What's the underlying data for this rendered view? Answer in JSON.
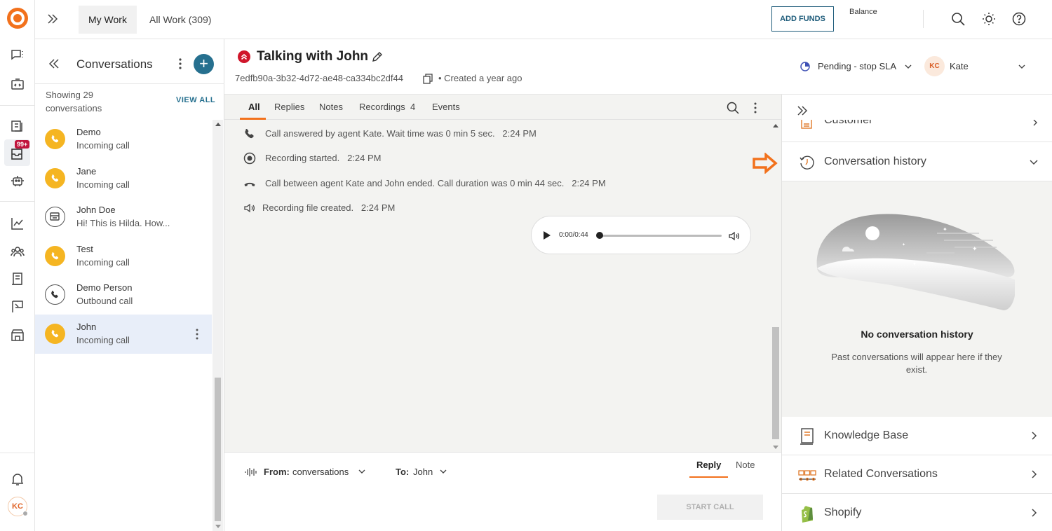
{
  "topbar": {
    "tabs": [
      {
        "label": "My Work",
        "active": true
      },
      {
        "label": "All Work (309)",
        "active": false
      }
    ],
    "add_funds_label": "ADD FUNDS",
    "balance_label": "Balance"
  },
  "rail": {
    "items": [
      "chat-icon",
      "widget-code-icon",
      "tickets-icon",
      "inbox-icon",
      "bot-icon",
      "reports-icon",
      "contacts-icon",
      "knowledge-icon",
      "campaigns-icon",
      "store-icon"
    ],
    "inbox_badge": "99+",
    "user_initials": "KC"
  },
  "conversations": {
    "title": "Conversations",
    "showing_text": "Showing 29 conversations",
    "view_all_label": "VIEW ALL",
    "items": [
      {
        "name": "Demo",
        "subtitle": "Incoming call",
        "icon": "call",
        "active": false
      },
      {
        "name": "Jane",
        "subtitle": "Incoming call",
        "icon": "call",
        "active": false
      },
      {
        "name": "John Doe",
        "subtitle": "Hi! This is Hilda. How...",
        "icon": "chat",
        "active": false
      },
      {
        "name": "Test",
        "subtitle": "Incoming call",
        "icon": "call",
        "active": false
      },
      {
        "name": "Demo Person",
        "subtitle": "Outbound call",
        "icon": "outbound",
        "active": false
      },
      {
        "name": "John",
        "subtitle": "Incoming call",
        "icon": "call",
        "active": true
      }
    ]
  },
  "conversation": {
    "title": "Talking with John",
    "id": "7edfb90a-3b32-4d72-ae48-ca334bc2df44",
    "created": "• Created a year ago",
    "status": "Pending - stop SLA",
    "agent_initials": "KC",
    "agent_name": "Kate"
  },
  "timeline": {
    "tabs": [
      {
        "label": "All",
        "active": true
      },
      {
        "label": "Replies",
        "active": false
      },
      {
        "label": "Notes",
        "active": false
      },
      {
        "label": "Recordings",
        "count": "4",
        "active": false
      },
      {
        "label": "Events",
        "active": false
      }
    ],
    "events": [
      {
        "icon": "phone-icon",
        "text": "Call answered by agent Kate. Wait time was 0 min 5 sec.",
        "time": "2:24 PM"
      },
      {
        "icon": "record-icon",
        "text": "Recording started.",
        "time": "2:24 PM"
      },
      {
        "icon": "hangup-icon",
        "text": "Call between agent Kate and John ended. Call duration was 0 min 44 sec.",
        "time": "2:24 PM"
      },
      {
        "icon": "speaker-icon",
        "text": "Recording file created.",
        "time": "2:24 PM"
      }
    ],
    "player": {
      "time": "0:00/0:44",
      "progress": 0
    }
  },
  "composer": {
    "from_label": "From:",
    "from_value": "conversations",
    "to_label": "To:",
    "to_value": "John",
    "reply_tab": "Reply",
    "note_tab": "Note",
    "start_call_label": "START CALL"
  },
  "rightpanel": {
    "customer_label": "Customer",
    "history_label": "Conversation history",
    "history_empty_title": "No conversation history",
    "history_empty_sub": "Past conversations will appear here if they exist.",
    "sections": [
      "Knowledge Base",
      "Related Conversations",
      "Shopify"
    ]
  },
  "colors": {
    "accent": "#f2711c",
    "primary": "#26708f",
    "priority": "#d0162b",
    "call_avatar": "#f5b522"
  }
}
